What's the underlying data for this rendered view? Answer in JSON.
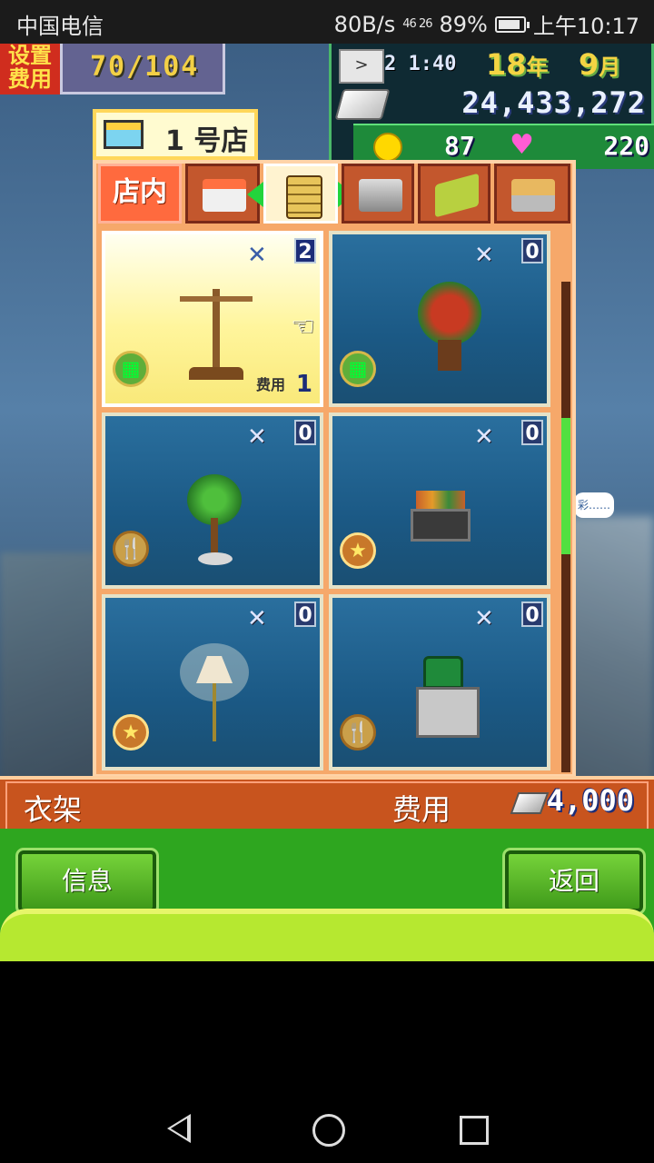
{
  "status_bar": {
    "carrier": "中国电信",
    "net_speed": "80B/s",
    "signal_label": "46 26",
    "battery_pct": "89%",
    "battery_level": 0.89,
    "time": "上午10:17"
  },
  "hud": {
    "cost_label": "设置费用",
    "cost_value": "70/104",
    "clock_time": "2 1:40",
    "year": "18",
    "year_unit": "年",
    "month": "9",
    "month_unit": "月",
    "money": "24,433,272",
    "coins": "87",
    "hearts": "220"
  },
  "store": {
    "name": "1 号店"
  },
  "tabs": [
    {
      "label": "店内",
      "icon": "shop-interior-icon"
    },
    {
      "label": "",
      "icon": "cake-display-icon"
    },
    {
      "label": "",
      "icon": "shelf-icon"
    },
    {
      "label": "",
      "icon": "cash-register-icon"
    },
    {
      "label": "",
      "icon": "sign-icon"
    },
    {
      "label": "",
      "icon": "bench-icon"
    }
  ],
  "items": [
    {
      "name": "衣架",
      "icon": "coat-rack-icon",
      "x": "✕",
      "count": "2",
      "badge": "basket-icon",
      "fee_label": "费用",
      "fee": "1",
      "selected": true
    },
    {
      "name": "",
      "icon": "flower-plant-icon",
      "x": "✕",
      "count": "0",
      "badge": "basket-icon"
    },
    {
      "name": "",
      "icon": "potted-tree-icon",
      "x": "✕",
      "count": "0",
      "badge": "cutlery-icon"
    },
    {
      "name": "",
      "icon": "produce-crate-icon",
      "x": "✕",
      "count": "0",
      "badge": "star-icon"
    },
    {
      "name": "",
      "icon": "floor-lamp-icon",
      "x": "✕",
      "count": "0",
      "badge": "star-icon"
    },
    {
      "name": "",
      "icon": "counter-icon",
      "x": "✕",
      "count": "0",
      "badge": "cutlery-icon"
    }
  ],
  "speech_bubble": "彩……",
  "info_bar": {
    "item_name": "衣架",
    "cost_label": "费用",
    "cost_amount": "4,000"
  },
  "buttons": {
    "info": "信息",
    "back": "返回"
  },
  "colors": {
    "panel": "#f6a86a",
    "selected_cell": "#fff59c",
    "bottom_green": "#2ea61f",
    "info_bar": "#c8541e"
  }
}
